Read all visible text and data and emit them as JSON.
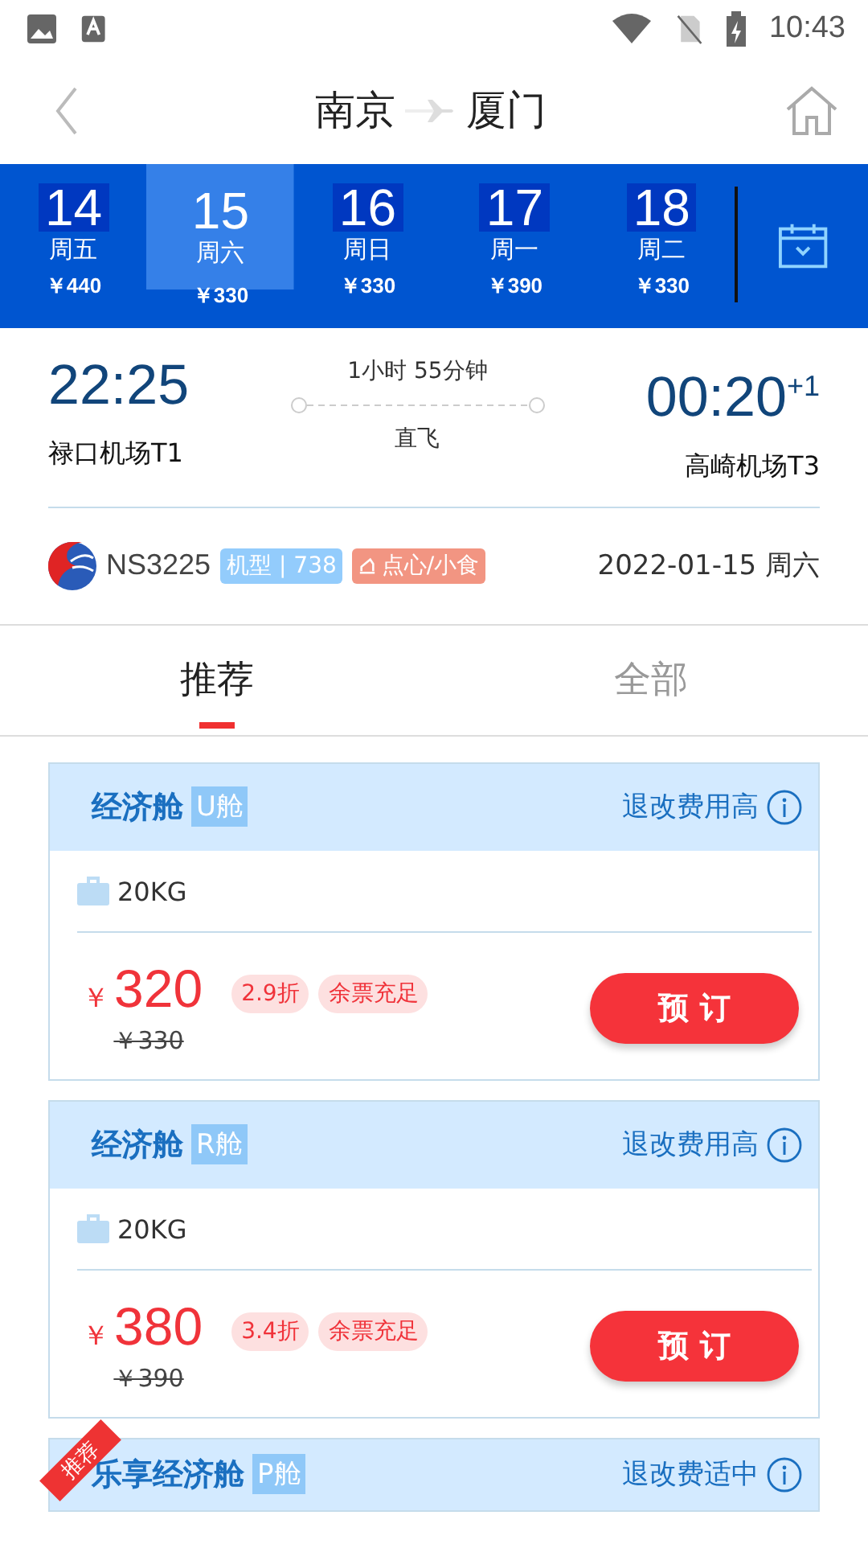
{
  "status_bar": {
    "time": "10:43"
  },
  "header": {
    "origin": "南京",
    "destination": "厦门"
  },
  "dates": [
    {
      "day": "14",
      "weekday": "周五",
      "price": "￥440",
      "selected": false
    },
    {
      "day": "15",
      "weekday": "周六",
      "price": "￥330",
      "selected": true
    },
    {
      "day": "16",
      "weekday": "周日",
      "price": "￥330",
      "selected": false
    },
    {
      "day": "17",
      "weekday": "周一",
      "price": "￥390",
      "selected": false
    },
    {
      "day": "18",
      "weekday": "周二",
      "price": "￥330",
      "selected": false
    }
  ],
  "flight": {
    "depart_time": "22:25",
    "depart_airport": "禄口机场T1",
    "duration": "1小时 55分钟",
    "stops": "直飞",
    "arrive_time": "00:20",
    "day_offset": "+1",
    "arrive_airport": "高崎机场T3",
    "flight_no": "NS3225",
    "aircraft": "机型 | 738",
    "meal": "点心/小食",
    "date": "2022-01-15 周六"
  },
  "tabs": [
    {
      "label": "推荐",
      "selected": true
    },
    {
      "label": "全部",
      "selected": false
    }
  ],
  "fares": [
    {
      "cabin": "经济舱",
      "class": "U舱",
      "refund": "退改费用高",
      "baggage": "20KG",
      "currency": "￥",
      "price": "320",
      "original": "￥330",
      "discount": "2.9折",
      "availability": "余票充足",
      "button": "预 订",
      "recommended": false
    },
    {
      "cabin": "经济舱",
      "class": "R舱",
      "refund": "退改费用高",
      "baggage": "20KG",
      "currency": "￥",
      "price": "380",
      "original": "￥390",
      "discount": "3.4折",
      "availability": "余票充足",
      "button": "预 订",
      "recommended": false
    },
    {
      "cabin": "乐享经济舱",
      "class": "P舱",
      "refund": "退改费适中",
      "recommended": true,
      "badge": "推荐"
    }
  ]
}
